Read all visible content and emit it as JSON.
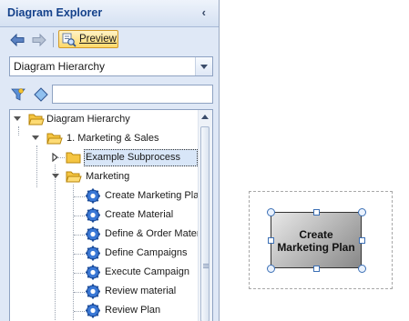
{
  "panel": {
    "title": "Diagram Explorer",
    "collapse_glyph": "‹"
  },
  "toolbar": {
    "preview_label": "Preview",
    "back_icon": "arrow-left-icon",
    "forward_icon": "arrow-right-icon",
    "preview_icon": "preview-icon"
  },
  "dropdown": {
    "selected": "Diagram Hierarchy"
  },
  "filter": {
    "value": "",
    "placeholder": ""
  },
  "tree": {
    "root": "Diagram Hierarchy",
    "group": "1. Marketing & Sales",
    "subprocess": "Example Subprocess",
    "folder": "Marketing",
    "items": [
      "Create Marketing Plan",
      "Create Material",
      "Define & Order Material",
      "Define Campaigns",
      "Execute Campaign",
      "Review material",
      "Review Plan"
    ]
  },
  "canvas": {
    "shape_label_line1": "Create",
    "shape_label_line2": "Marketing Plan"
  },
  "colors": {
    "panel_bg": "#dfe8f6",
    "title_text": "#15428b",
    "preview_bg": "#ffd96a",
    "selection_bg": "#d8e6f8",
    "handle_border": "#3b6fb5"
  }
}
